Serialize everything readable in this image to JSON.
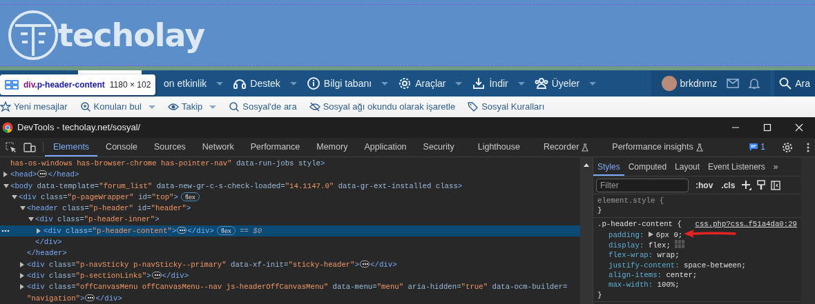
{
  "site": {
    "logo": "techolay",
    "nav_items": [
      {
        "label": "on etkinlik"
      },
      {
        "label": "Destek"
      },
      {
        "label": "Bilgi tabanı"
      },
      {
        "label": "Araçlar"
      },
      {
        "label": "İndir"
      },
      {
        "label": "Üyeler"
      }
    ],
    "user": {
      "name": "brkdnmz"
    },
    "search_label": "Ara",
    "sub_nav": [
      {
        "label": "Yeni mesajlar",
        "dropdown": false
      },
      {
        "label": "Konuları bul",
        "dropdown": true
      },
      {
        "label": "Takip",
        "dropdown": true
      },
      {
        "label": "Sosyal'de ara",
        "dropdown": false
      },
      {
        "label": "Sosyal ağı okundu olarak işaretle",
        "dropdown": false
      },
      {
        "label": "Sosyal Kuralları",
        "dropdown": false
      }
    ]
  },
  "tooltip": {
    "tag": "div",
    "selector": ".p-header-content",
    "size": "1180 × 102"
  },
  "devtools": {
    "title": "DevTools - techolay.net/sosyal/",
    "tabs": [
      {
        "label": "Elements",
        "selected": true,
        "experimental": false
      },
      {
        "label": "Console",
        "selected": false,
        "experimental": false
      },
      {
        "label": "Sources",
        "selected": false,
        "experimental": false
      },
      {
        "label": "Network",
        "selected": false,
        "experimental": false
      },
      {
        "label": "Performance",
        "selected": false,
        "experimental": false
      },
      {
        "label": "Memory",
        "selected": false,
        "experimental": false
      },
      {
        "label": "Application",
        "selected": false,
        "experimental": false
      },
      {
        "label": "Security",
        "selected": false,
        "experimental": false
      },
      {
        "label": "Lighthouse",
        "selected": false,
        "experimental": false
      },
      {
        "label": "Recorder",
        "selected": false,
        "experimental": true
      },
      {
        "label": "Performance insights",
        "selected": false,
        "experimental": true
      }
    ],
    "issues_count": "1",
    "dom": [
      {
        "line": [
          {
            "kind": "value",
            "text": "has-os-windows has-browser-chrome has-pointer-nav\""
          },
          {
            "kind": "attr",
            "text": " data-run-jobs style"
          },
          {
            "kind": "tag",
            "text": ">"
          }
        ]
      },
      {
        "expanded": false,
        "line": [
          {
            "kind": "tag",
            "text": "<head>"
          },
          {
            "kind": "ellipsis"
          },
          {
            "kind": "tag",
            "text": "</head>"
          }
        ]
      },
      {
        "expanded": true,
        "line": [
          {
            "kind": "tag",
            "text": "<body"
          },
          {
            "kind": "attr",
            "text": " data-template="
          },
          {
            "kind": "value",
            "text": "\"forum_list\""
          },
          {
            "kind": "attr",
            "text": " data-new-gr-c-s-check-loaded="
          },
          {
            "kind": "value",
            "text": "\"14.1147.0\""
          },
          {
            "kind": "attr",
            "text": " data-gr-ext-installed class"
          },
          {
            "kind": "tag",
            "text": ">"
          }
        ],
        "children": [
          {
            "expanded": true,
            "line": [
              {
                "kind": "tag",
                "text": "<div"
              },
              {
                "kind": "attr",
                "text": " class="
              },
              {
                "kind": "value",
                "text": "\"p-pageWrapper\""
              },
              {
                "kind": "attr",
                "text": " id="
              },
              {
                "kind": "value",
                "text": "\"top\""
              },
              {
                "kind": "tag",
                "text": ">"
              },
              {
                "kind": "badge",
                "text": "flex"
              }
            ],
            "children": [
              {
                "expanded": true,
                "line": [
                  {
                    "kind": "tag",
                    "text": "<header"
                  },
                  {
                    "kind": "attr",
                    "text": " class="
                  },
                  {
                    "kind": "value",
                    "text": "\"p-header\""
                  },
                  {
                    "kind": "attr",
                    "text": " id="
                  },
                  {
                    "kind": "value",
                    "text": "\"header\""
                  },
                  {
                    "kind": "tag",
                    "text": ">"
                  }
                ],
                "children": [
                  {
                    "expanded": true,
                    "line": [
                      {
                        "kind": "tag",
                        "text": "<div"
                      },
                      {
                        "kind": "attr",
                        "text": " class="
                      },
                      {
                        "kind": "value",
                        "text": "\"p-header-inner\""
                      },
                      {
                        "kind": "tag",
                        "text": ">"
                      }
                    ],
                    "children": [
                      {
                        "expanded": false,
                        "selected": true,
                        "line": [
                          {
                            "kind": "tag",
                            "text": "<div"
                          },
                          {
                            "kind": "attr",
                            "text": " class="
                          },
                          {
                            "kind": "value",
                            "text": "\"p-header-content\""
                          },
                          {
                            "kind": "tag",
                            "text": ">"
                          },
                          {
                            "kind": "ellipsis"
                          },
                          {
                            "kind": "tag",
                            "text": "</div>"
                          },
                          {
                            "kind": "badge",
                            "text": "flex"
                          },
                          {
                            "kind": "marker",
                            "text": "== $0"
                          }
                        ]
                      }
                    ],
                    "close": [
                      {
                        "kind": "tag",
                        "text": "</div>"
                      }
                    ]
                  }
                ],
                "close": [
                  {
                    "kind": "tag",
                    "text": "</header>"
                  }
                ]
              },
              {
                "expanded": false,
                "line": [
                  {
                    "kind": "tag",
                    "text": "<div"
                  },
                  {
                    "kind": "attr",
                    "text": " class="
                  },
                  {
                    "kind": "value",
                    "text": "\"p-navSticky p-navSticky--primary\""
                  },
                  {
                    "kind": "attr",
                    "text": " data-xf-init="
                  },
                  {
                    "kind": "value",
                    "text": "\"sticky-header\""
                  },
                  {
                    "kind": "tag",
                    "text": ">"
                  },
                  {
                    "kind": "ellipsis"
                  },
                  {
                    "kind": "tag",
                    "text": "</div>"
                  }
                ]
              },
              {
                "expanded": false,
                "line": [
                  {
                    "kind": "tag",
                    "text": "<div"
                  },
                  {
                    "kind": "attr",
                    "text": " class="
                  },
                  {
                    "kind": "value",
                    "text": "\"p-sectionLinks\""
                  },
                  {
                    "kind": "tag",
                    "text": ">"
                  },
                  {
                    "kind": "ellipsis"
                  },
                  {
                    "kind": "tag",
                    "text": "</div>"
                  }
                ]
              },
              {
                "expanded": false,
                "line": [
                  {
                    "kind": "tag",
                    "text": "<div"
                  },
                  {
                    "kind": "attr",
                    "text": " class="
                  },
                  {
                    "kind": "value",
                    "text": "\"offCanvasMenu offCanvasMenu--nav js-headerOffCanvasMenu\""
                  },
                  {
                    "kind": "attr",
                    "text": " data-menu="
                  },
                  {
                    "kind": "value",
                    "text": "\"menu\""
                  },
                  {
                    "kind": "attr",
                    "text": " aria-hidden="
                  },
                  {
                    "kind": "value",
                    "text": "\"true\""
                  },
                  {
                    "kind": "attr",
                    "text": " data-ocm-builder="
                  },
                  {
                    "kind": "value",
                    "text": "\"navigation\""
                  },
                  {
                    "kind": "tag",
                    "text": ">"
                  },
                  {
                    "kind": "ellipsis"
                  },
                  {
                    "kind": "tag",
                    "text": "</div>"
                  }
                ]
              }
            ]
          }
        ]
      }
    ],
    "side_tabs": [
      {
        "label": "Styles",
        "selected": true
      },
      {
        "label": "Computed",
        "selected": false
      },
      {
        "label": "Layout",
        "selected": false
      },
      {
        "label": "Event Listeners",
        "selected": false
      }
    ],
    "more_tabs": "»",
    "filter": {
      "placeholder": "Filter"
    },
    "filter_buttons": [
      ":hov",
      ".cls"
    ],
    "rules": [
      {
        "selector": "element.style {",
        "close": "}"
      },
      {
        "selector": ".p-header-content {",
        "source": "css.php?css…f51a4da0:29",
        "close": "}",
        "declarations": [
          {
            "property": "padding:",
            "value": "6px 0;",
            "expandable": true,
            "flex_editor": false
          },
          {
            "property": "display:",
            "value": "flex;",
            "expandable": false,
            "flex_editor": true
          },
          {
            "property": "flex-wrap:",
            "value": "wrap;",
            "expandable": false,
            "flex_editor": false
          },
          {
            "property": "justify-content:",
            "value": "space-between;",
            "expandable": false,
            "flex_editor": false
          },
          {
            "property": "align-items:",
            "value": "center;",
            "expandable": false,
            "flex_editor": false
          },
          {
            "property": "max-width:",
            "value": "100%;",
            "expandable": false,
            "flex_editor": false
          }
        ]
      }
    ]
  }
}
